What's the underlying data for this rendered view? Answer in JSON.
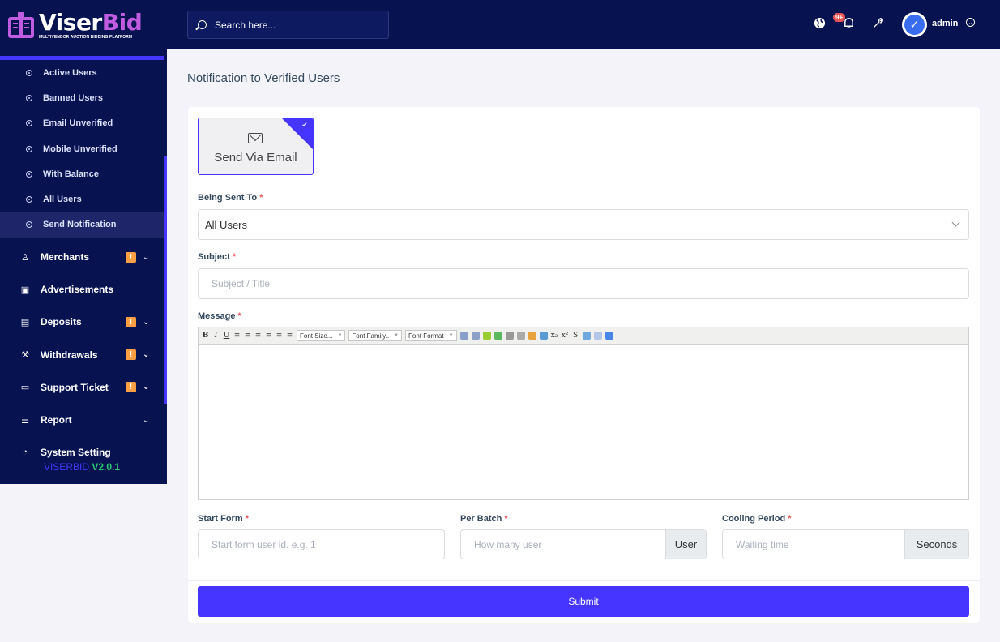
{
  "brand": {
    "name_a": "Viser",
    "name_b": "Bid",
    "tagline": "MULTIVENDOR AUCTION BIDDING PLATFORM"
  },
  "version": {
    "name": "VISERBID",
    "number": "V2.0.1"
  },
  "sidebar": {
    "submenu": [
      {
        "label": "Active Users",
        "active": false
      },
      {
        "label": "Banned Users",
        "active": false
      },
      {
        "label": "Email Unverified",
        "active": false
      },
      {
        "label": "Mobile Unverified",
        "active": false
      },
      {
        "label": "With Balance",
        "active": false
      },
      {
        "label": "All Users",
        "active": false
      },
      {
        "label": "Send Notification",
        "active": true
      }
    ],
    "menu": [
      {
        "label": "Merchants",
        "icon": "users-icon",
        "badge": "!",
        "chevron": true
      },
      {
        "label": "Advertisements",
        "icon": "ad-icon",
        "badge": "",
        "chevron": false
      },
      {
        "label": "Deposits",
        "icon": "file-dollar-icon",
        "badge": "!",
        "chevron": true
      },
      {
        "label": "Withdrawals",
        "icon": "bank-icon",
        "badge": "!",
        "chevron": true
      },
      {
        "label": "Support Ticket",
        "icon": "ticket-icon",
        "badge": "!",
        "chevron": true
      },
      {
        "label": "Report",
        "icon": "list-icon",
        "badge": "",
        "chevron": true
      },
      {
        "label": "System Setting",
        "icon": "gauge-icon",
        "badge": "",
        "chevron": false
      }
    ]
  },
  "header": {
    "search_placeholder": "Search here...",
    "notification_count": "9+",
    "admin_name": "admin"
  },
  "page": {
    "title": "Notification to Verified Users",
    "send_via": "Send Via Email",
    "being_sent_to_label": "Being Sent To",
    "being_sent_to_value": "All Users",
    "subject_label": "Subject",
    "subject_placeholder": "Subject / Title",
    "message_label": "Message",
    "toolbar": {
      "font_size": "Font Size...",
      "font_family": "Font Family..",
      "font_format": "Font Format"
    },
    "start_form_label": "Start Form",
    "start_form_placeholder": "Start form user id. e.g. 1",
    "per_batch_label": "Per Batch",
    "per_batch_placeholder": "How many user",
    "per_batch_addon": "User",
    "cooling_label": "Cooling Period",
    "cooling_placeholder": "Waiting time",
    "cooling_addon": "Seconds",
    "required_mark": "*",
    "submit_label": "Submit"
  },
  "colors": {
    "primary": "#4634ff",
    "sidebar_bg": "#071251",
    "warning": "#ff9f43",
    "danger": "#ea5455",
    "success": "#28c76f"
  }
}
